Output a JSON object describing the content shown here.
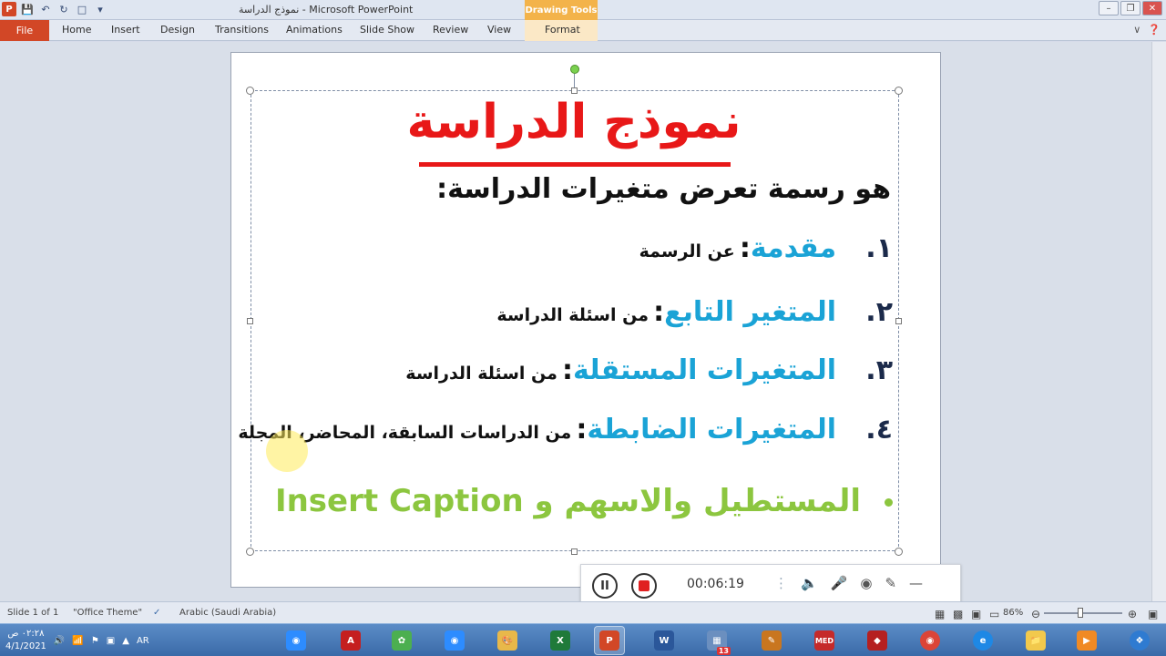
{
  "window": {
    "title": "نموذج الدراسة - Microsoft PowerPoint",
    "contextual_tab_group": "Drawing Tools"
  },
  "ribbon": {
    "file_label": "File",
    "tabs": [
      "Home",
      "Insert",
      "Design",
      "Transitions",
      "Animations",
      "Slide Show",
      "Review",
      "View",
      "Format"
    ]
  },
  "slide": {
    "title": "نموذج الدراسة",
    "subtitle": "هو رسمة تعرض متغيرات الدراسة:",
    "items": [
      {
        "num": "١.",
        "term": "مقدمة",
        "colon": ":",
        "desc": "عن الرسمة"
      },
      {
        "num": "٢.",
        "term": "المتغير التابع",
        "colon": ":",
        "desc": "من اسئلة الدراسة"
      },
      {
        "num": "٣.",
        "term": "المتغيرات المستقلة",
        "colon": ":",
        "desc": "من اسئلة الدراسة"
      },
      {
        "num": "٤.",
        "term": "المتغيرات الضابطة",
        "colon": ":",
        "desc": "من الدراسات السابقة، المحاضر، المجلة"
      }
    ],
    "bullet_text": "المستطيل والاسهم و Insert Caption",
    "colors": {
      "title": "#e81818",
      "term": "#1aa3d6",
      "bullet": "#8cc63f"
    }
  },
  "recorder": {
    "time": "00:06:19",
    "icons": [
      "pause-icon",
      "stop-icon",
      "speaker-muted-icon",
      "mic-icon",
      "webcam-off-icon",
      "pen-icon",
      "minimize-icon"
    ]
  },
  "statusbar": {
    "slide_info": "Slide 1 of 1",
    "theme": "\"Office Theme\"",
    "language": "Arabic (Saudi Arabia)",
    "zoom": "86%"
  },
  "taskbar": {
    "time": "٠٢:٢٨ ص",
    "date": "4/1/2021",
    "lang": "AR",
    "badge_count": "13",
    "med_label": "MED"
  }
}
